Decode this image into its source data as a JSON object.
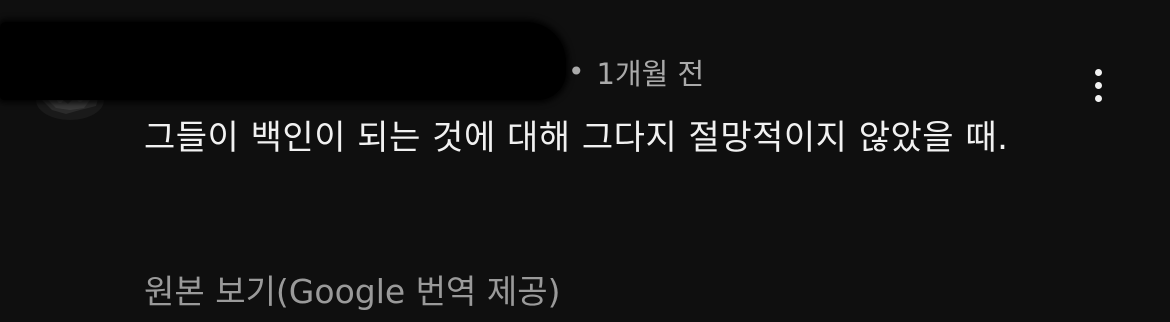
{
  "comment": {
    "timestamp": "1개월 전",
    "separator": "•",
    "text": "그들이 백인이 되는 것에 대해 그다지 절망적이지 않았을 때.",
    "translation_link": "원본 보기(Google 번역 제공)",
    "more_icon": "more-vertical-icon"
  },
  "colors": {
    "background": "#0f0f0f",
    "text_primary": "#f1f1f1",
    "text_secondary": "#aaaaaa",
    "link_muted": "#9a9a9a"
  }
}
